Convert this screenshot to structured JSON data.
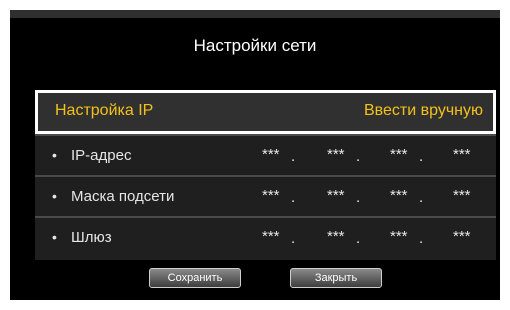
{
  "title": "Настройки сети",
  "ip_setting": {
    "label": "Настройка IP",
    "value": "Ввести вручную"
  },
  "rows": [
    {
      "bullet": "•",
      "label": "IP-адрес",
      "octets": [
        "***",
        "***",
        "***",
        "***"
      ]
    },
    {
      "bullet": "•",
      "label": "Маска подсети",
      "octets": [
        "***",
        "***",
        "***",
        "***"
      ]
    },
    {
      "bullet": "•",
      "label": "Шлюз",
      "octets": [
        "***",
        "***",
        "***",
        "***"
      ]
    }
  ],
  "separator": ".",
  "buttons": {
    "save": "Сохранить",
    "close": "Закрыть"
  },
  "colors": {
    "background": "#000000",
    "panel": "#1f1f1f",
    "accent": "#f2c21b",
    "highlight_border": "#ffffff"
  }
}
